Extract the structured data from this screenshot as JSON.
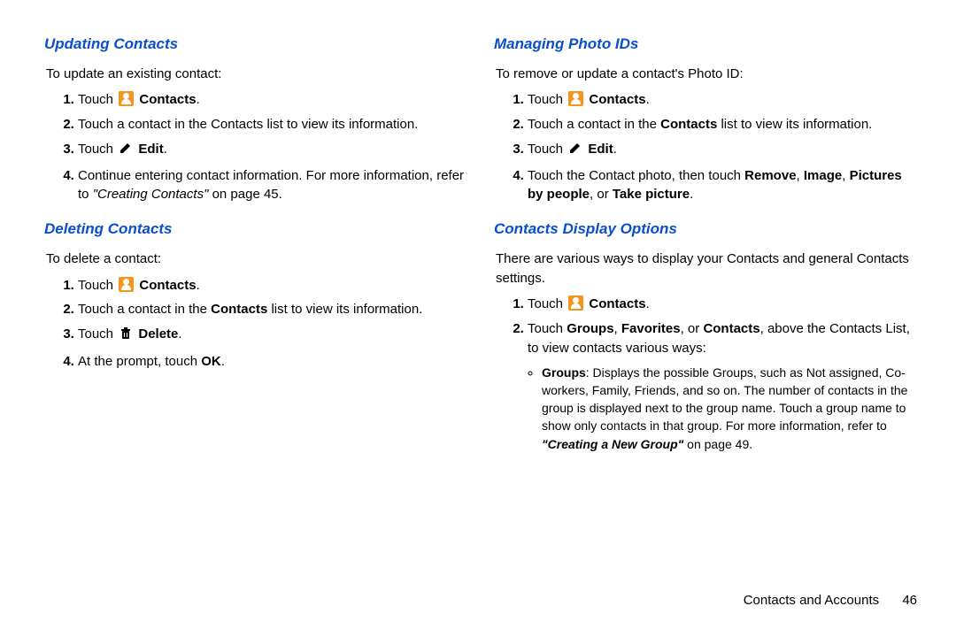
{
  "left": {
    "sec1": {
      "heading": "Updating Contacts",
      "lead": "To update an existing contact:",
      "step1a": "Touch ",
      "step1b": "Contacts",
      "step1c": ".",
      "step2": "Touch a contact in the Contacts list to view its information.",
      "step3a": "Touch ",
      "step3b": "Edit",
      "step3c": ".",
      "step4a": "Continue entering contact information. For more information, refer to ",
      "step4ref": "\"Creating Contacts\"",
      "step4b": " on page 45."
    },
    "sec2": {
      "heading": "Deleting Contacts",
      "lead": "To delete a contact:",
      "step1a": "Touch ",
      "step1b": "Contacts",
      "step1c": ".",
      "step2a": "Touch a contact in the ",
      "step2b": "Contacts",
      "step2c": " list to view its information.",
      "step3a": "Touch ",
      "step3b": "Delete",
      "step3c": ".",
      "step4a": "At the prompt, touch ",
      "step4b": "OK",
      "step4c": "."
    }
  },
  "right": {
    "sec1": {
      "heading": "Managing Photo IDs",
      "lead": "To remove or update a contact's Photo ID:",
      "step1a": "Touch ",
      "step1b": "Contacts",
      "step1c": ".",
      "step2a": "Touch a contact in the ",
      "step2b": "Contacts",
      "step2c": " list to view its information.",
      "step3a": "Touch ",
      "step3b": "Edit",
      "step3c": ".",
      "step4a": "Touch the Contact photo, then touch ",
      "step4b": "Remove",
      "step4c": ", ",
      "step4d": "Image",
      "step4e": ", ",
      "step4f": "Pictures by people",
      "step4g": ", or ",
      "step4h": "Take picture",
      "step4i": "."
    },
    "sec2": {
      "heading": "Contacts Display Options",
      "lead": "There are various ways to display your Contacts and general Contacts settings.",
      "step1a": "Touch ",
      "step1b": "Contacts",
      "step1c": ".",
      "step2a": "Touch ",
      "step2b": "Groups",
      "step2c": ", ",
      "step2d": "Favorites",
      "step2e": ", or ",
      "step2f": "Contacts",
      "step2g": ", above the Contacts List, to view contacts various ways:",
      "bullet1a": "Groups",
      "bullet1b": ": Displays the possible Groups, such as Not assigned, Co-workers, Family, Friends, and so on. The number of contacts in the group is displayed next to the group name. Touch a group name to show only contacts in that group. For more information, refer to ",
      "bullet1ref": "\"Creating a New Group\"",
      "bullet1c": " on page 49."
    }
  },
  "footer": {
    "chapter": "Contacts and Accounts",
    "page": "46"
  }
}
